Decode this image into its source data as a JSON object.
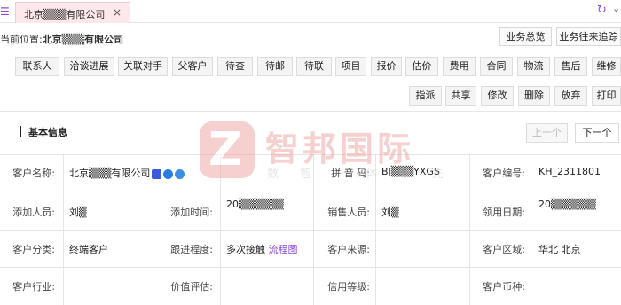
{
  "tab": {
    "label": "北京▒▒▒有限公司",
    "close": "×"
  },
  "breadcrumb": {
    "prefix": "当前位置:",
    "current": "北京▒▒▒有限公司"
  },
  "top_buttons": [
    "业务总览",
    "业务往来追踪"
  ],
  "toolbar_row1": [
    "联系人",
    "洽谈进展",
    "关联对手",
    "父客户",
    "待查",
    "待邮",
    "待联",
    "项目",
    "报价",
    "估价",
    "费用",
    "合同",
    "物流",
    "售后",
    "维修"
  ],
  "toolbar_row2": [
    "指派",
    "共享",
    "修改",
    "删除",
    "放弃",
    "打印"
  ],
  "section": {
    "title": "基本信息",
    "prev": "上一个",
    "next": "下一个"
  },
  "fields": {
    "r1": {
      "l1": "客户名称:",
      "v1": "北京▒▒▒有限公司",
      "l2": "",
      "v2": "",
      "l3": "拼 音 码:",
      "v3": "BJ▒▒▒YXGS",
      "l4": "客户编号:",
      "v4": "KH_2311801"
    },
    "r2": {
      "l1": "添加人员:",
      "v1": "刘▒",
      "l2": "添加时间:",
      "v2": "20▒▒▒▒▒▒",
      "l3": "销售人员:",
      "v3": "刘▒",
      "l4": "领用日期:",
      "v4": "20▒▒▒▒▒▒"
    },
    "r3": {
      "l1": "客户分类:",
      "v1": "终端客户",
      "l2": "跟进程度:",
      "v2": "多次接触",
      "v2_link": "流程图",
      "l3": "客户来源:",
      "v3": "",
      "l4": "客户区域:",
      "v4": "华北 北京"
    },
    "r4": {
      "l1": "客户行业:",
      "v1": "",
      "l2": "价值评估:",
      "v2": "",
      "l3": "信用等级:",
      "v3": "",
      "l4": "客户币种:",
      "v4": ""
    }
  },
  "watermark": {
    "logo": "Z",
    "text": "智邦国际",
    "sub": "数 智 一 体 领 先"
  },
  "colors": {
    "accent": "#8a4bd8",
    "tab_bg": "#ffe8ec",
    "watermark": "#f0a9a9"
  }
}
